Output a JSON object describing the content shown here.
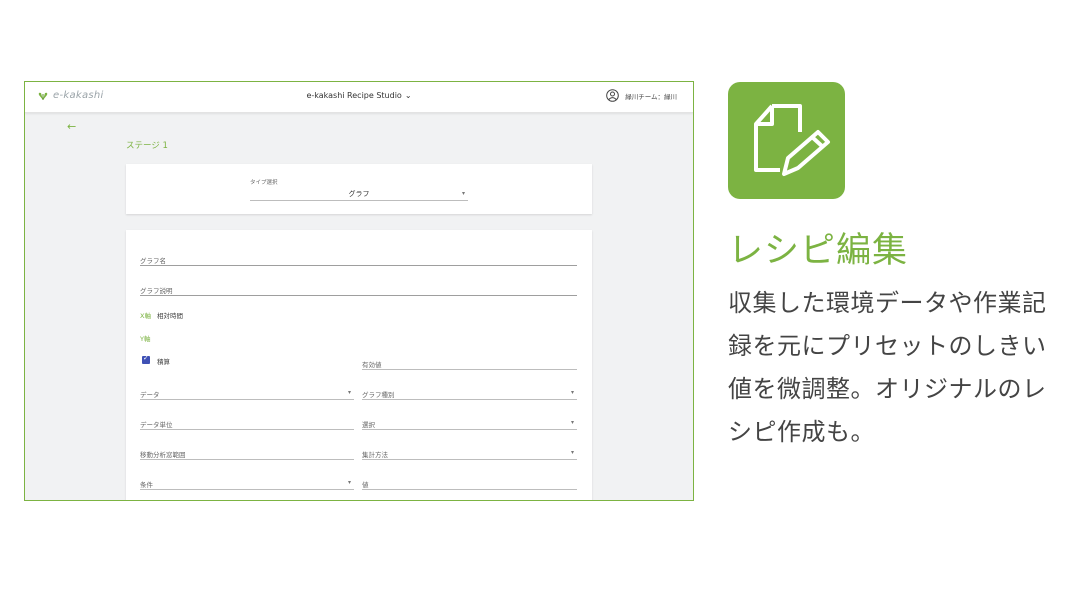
{
  "app": {
    "logo_text": "e-kakashi",
    "studio_title": "e-kakashi Recipe Studio",
    "user_label": "緑川チーム：緑川"
  },
  "page": {
    "stage_title": "ステージ 1"
  },
  "type_select": {
    "label": "タイプ選択",
    "value": "グラフ"
  },
  "form": {
    "graph_name_label": "グラフ名",
    "graph_desc_label": "グラフ説明",
    "x_axis_label": "X軸",
    "x_axis_value": "相対時間",
    "y_axis_label": "Y軸",
    "checkbox_label": "積算",
    "checkbox_checked": true,
    "valid_value_label": "有効値",
    "data_label": "データ",
    "graph_type_label": "グラフ種別",
    "data_unit_label": "データ単位",
    "select_label": "選択",
    "moving_range_label": "移動分析窓範囲",
    "aggregation_label": "集計方法",
    "condition_label": "条件",
    "value_label": "値"
  },
  "feature": {
    "title": "レシピ編集",
    "description": "収集した環境データや作業記録を元にプリセットのしきい値を微調整。オリジナルのレシピ作成も。"
  },
  "colors": {
    "brand_green": "#7cb342",
    "checkbox_blue": "#3f51b5"
  },
  "icons": [
    "leaf-logo-icon",
    "chevron-down-icon",
    "user-icon",
    "back-arrow-icon",
    "dropdown-caret-icon",
    "document-edit-icon"
  ]
}
